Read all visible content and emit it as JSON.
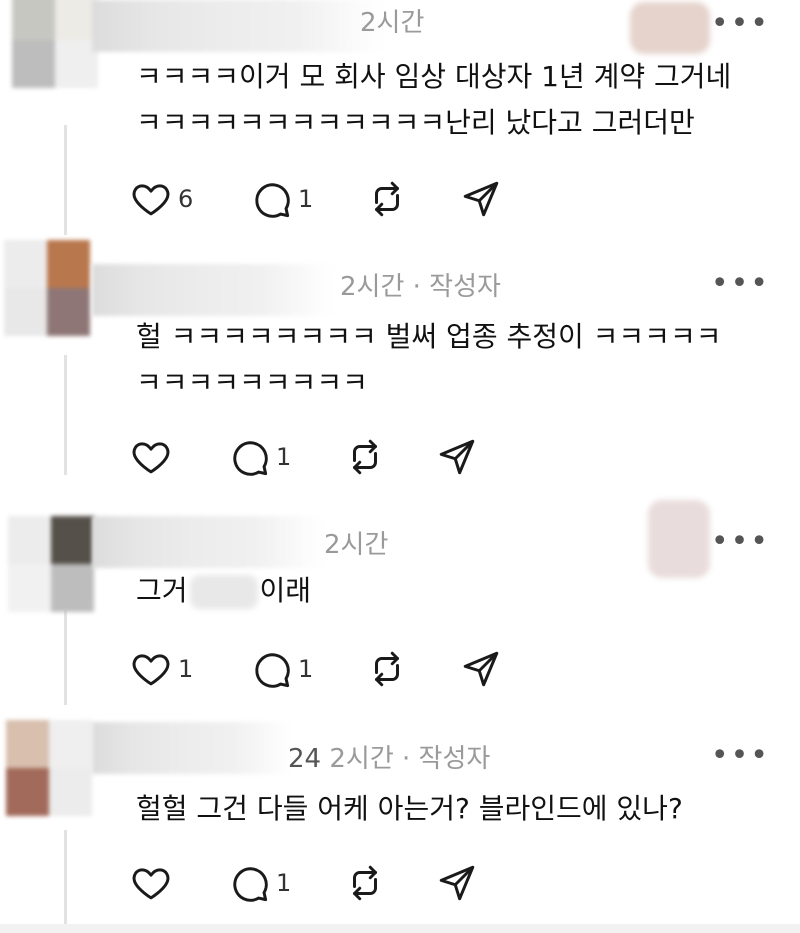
{
  "comments": [
    {
      "meta": "2시간",
      "lines": [
        "ㅋㅋㅋㅋ이거 모 회사 임상 대상자 1년 계약 그거네",
        "ㅋㅋㅋㅋㅋㅋㅋㅋㅋㅋㅋㅋ난리 났다고 그러더만"
      ],
      "likes": "6",
      "replies": "1"
    },
    {
      "meta": "2시간 · 작성자",
      "lines": [
        "헐 ㅋㅋㅋㅋㅋㅋㅋㅋ 벌써 업종 추정이 ㅋㅋㅋㅋㅋ",
        "ㅋㅋㅋㅋㅋㅋㅋㅋㅋ"
      ],
      "likes": "",
      "replies": "1"
    },
    {
      "meta": "2시간",
      "line_start": "그거",
      "line_end": "이래",
      "likes": "1",
      "replies": "1"
    },
    {
      "meta_prefix": "24",
      "meta": "2시간 · 작성자",
      "lines": [
        "헐헐 그건 다들 어케 아는거? 블라인드에 있나?"
      ],
      "likes": "",
      "replies": "1"
    }
  ],
  "icons": {
    "like": "heart-icon",
    "reply": "comment-icon",
    "repost": "repost-icon",
    "share": "send-icon",
    "more": "more-icon"
  },
  "more_label": "•••",
  "colors": {
    "text": "#111111",
    "meta": "#9a9a9a",
    "thread_line": "#e2e2e2"
  }
}
